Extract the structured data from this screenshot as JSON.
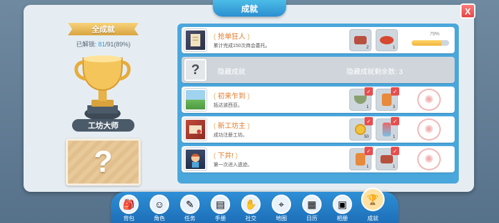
{
  "header": {
    "title": "成就",
    "close_label": "X"
  },
  "summary": {
    "ribbon": "全成就",
    "unlocked_prefix": "已解锁: ",
    "unlocked_count": "81",
    "unlocked_total": "/91(89%)",
    "trophy_name": "工坊大师",
    "mystery_symbol": "?"
  },
  "achievements": [
    {
      "title": "抢单狂人",
      "desc": "累计完成150次商会委托。",
      "rewards": [
        {
          "icon": "meat-icon",
          "count": "2"
        },
        {
          "icon": "dish-icon",
          "count": "1"
        }
      ],
      "progress_label": "79%",
      "progress": 0.79
    },
    {
      "hidden": true,
      "title": "隐藏成就",
      "remaining_label": "隐藏成就剩余数: 3"
    },
    {
      "title": "初来乍到",
      "desc": "抵达波西亚。",
      "rewards": [
        {
          "icon": "bowl-icon",
          "count": "1"
        },
        {
          "icon": "jar-icon",
          "count": "3"
        }
      ],
      "claimed": true
    },
    {
      "title": "新工坊主",
      "desc": "成功注册工坊。",
      "rewards": [
        {
          "icon": "coin-icon",
          "count": "50"
        },
        {
          "icon": "potion-icon",
          "count": "1"
        }
      ],
      "claimed": true
    },
    {
      "title": "下井!",
      "desc": "第一次进入遗迹。",
      "rewards": [
        {
          "icon": "jar-icon",
          "count": "1"
        },
        {
          "icon": "meat-icon",
          "count": "1"
        }
      ],
      "claimed": true
    }
  ],
  "dock": [
    {
      "label": "背包",
      "icon": "backpack-icon"
    },
    {
      "label": "角色",
      "icon": "character-icon"
    },
    {
      "label": "任务",
      "icon": "task-icon"
    },
    {
      "label": "手册",
      "icon": "handbook-icon"
    },
    {
      "label": "社交",
      "icon": "social-icon"
    },
    {
      "label": "地图",
      "icon": "map-icon"
    },
    {
      "label": "日历",
      "icon": "calendar-icon"
    },
    {
      "label": "相册",
      "icon": "album-icon"
    },
    {
      "label": "成就",
      "icon": "trophy-icon",
      "active": true
    }
  ],
  "colors": {
    "accent": "#2a9fd6",
    "list_bg": "#4aa7dc",
    "title_orange": "#e07a2a"
  }
}
